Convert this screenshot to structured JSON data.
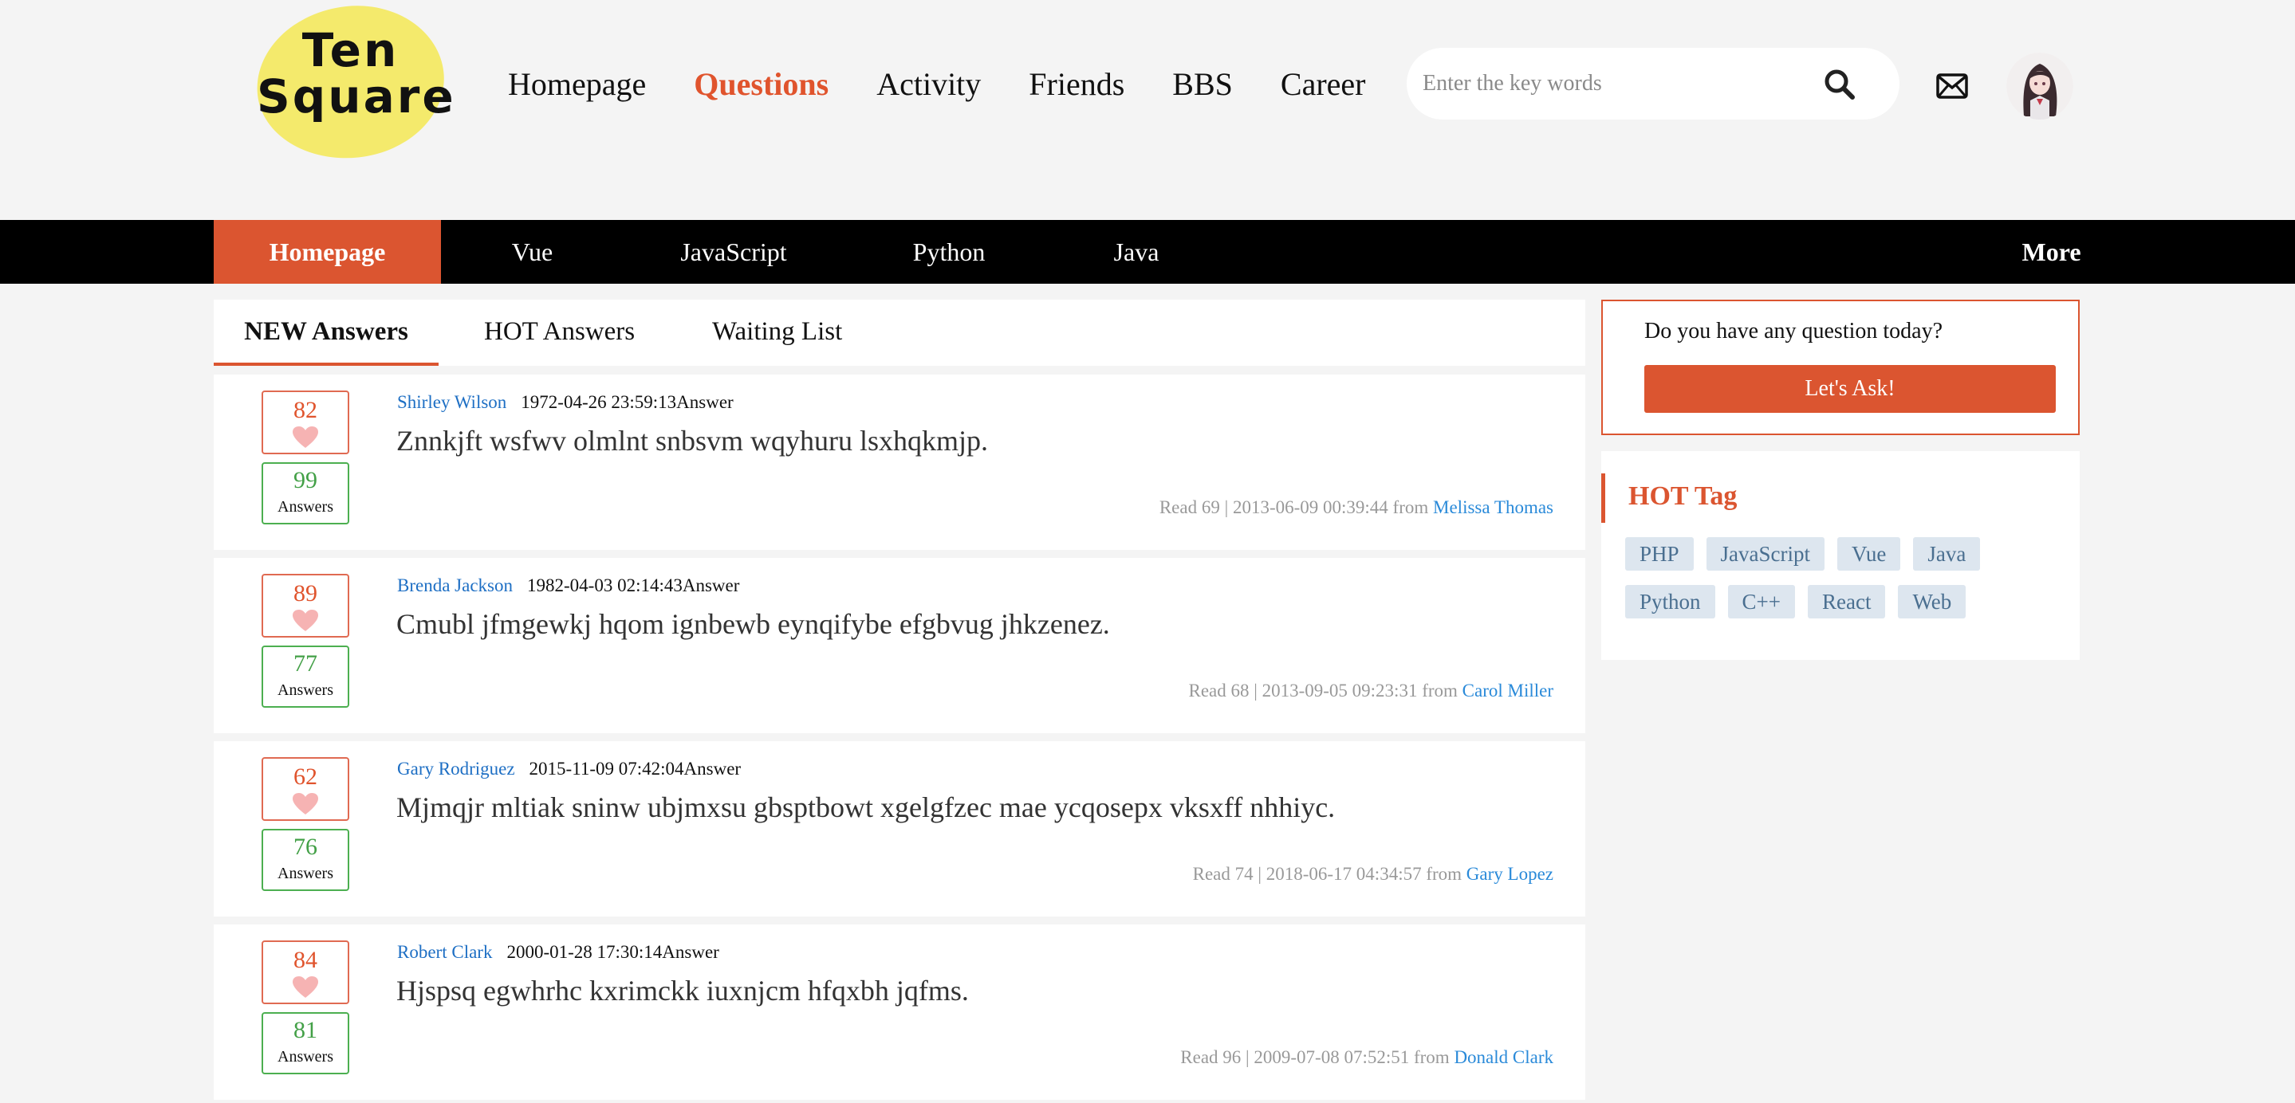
{
  "logo": {
    "line1": "Ten",
    "line2": "Square"
  },
  "nav": {
    "items": [
      {
        "label": "Homepage",
        "active": false
      },
      {
        "label": "Questions",
        "active": true
      },
      {
        "label": "Activity",
        "active": false
      },
      {
        "label": "Friends",
        "active": false
      },
      {
        "label": "BBS",
        "active": false
      },
      {
        "label": "Career",
        "active": false
      }
    ]
  },
  "search": {
    "placeholder": "Enter the key words",
    "icon": "search-icon"
  },
  "header_icons": {
    "mail": "mail-icon",
    "avatar": "avatar"
  },
  "categories": {
    "items": [
      "Homepage",
      "Vue",
      "JavaScript",
      "Python",
      "Java"
    ],
    "active": "Homepage",
    "more": "More"
  },
  "tabs": {
    "items": [
      "NEW Answers",
      "HOT Answers",
      "Waiting List"
    ],
    "active": "NEW Answers"
  },
  "questions": [
    {
      "likes": "82",
      "answers": "99",
      "answers_label": "Answers",
      "author": "Shirley Wilson",
      "time": "1972-04-26 23:59:13Answer",
      "title": "Znnkjft wsfwv olmlnt snbsvm wqyhuru lsxhqkmjp.",
      "read": "Read 69 | 2013-06-09 00:39:44 from ",
      "from": "Melissa Thomas"
    },
    {
      "likes": "89",
      "answers": "77",
      "answers_label": "Answers",
      "author": "Brenda Jackson",
      "time": "1982-04-03 02:14:43Answer",
      "title": "Cmubl jfmgewkj hqom ignbewb eynqifybe efgbvug jhkzenez.",
      "read": "Read 68 | 2013-09-05 09:23:31 from ",
      "from": "Carol Miller"
    },
    {
      "likes": "62",
      "answers": "76",
      "answers_label": "Answers",
      "author": "Gary Rodriguez",
      "time": "2015-11-09 07:42:04Answer",
      "title": "Mjmqjr mltiak sninw ubjmxsu gbsptbowt xgelgfzec mae ycqosepx vksxff nhhiyc.",
      "read": "Read 74 | 2018-06-17 04:34:57 from ",
      "from": "Gary Lopez"
    },
    {
      "likes": "84",
      "answers": "81",
      "answers_label": "Answers",
      "author": "Robert Clark",
      "time": "2000-01-28 17:30:14Answer",
      "title": "Hjspsq egwhrhc kxrimckk iuxnjcm hfqxbh jqfms.",
      "read": "Read 96 | 2009-07-08 07:52:51 from ",
      "from": "Donald Clark"
    }
  ],
  "ask": {
    "question": "Do you have any question today?",
    "button": "Let's Ask!"
  },
  "hot_tag": {
    "title": "HOT Tag",
    "tags": [
      "PHP",
      "JavaScript",
      "Vue",
      "Java",
      "Python",
      "C++",
      "React",
      "Web"
    ]
  },
  "colors": {
    "accent": "#db5530",
    "likes": "#e0542d",
    "answers": "#43a047",
    "link": "#1e6fc4",
    "logo": "#f4ea6c",
    "tag_bg": "#dde6ef"
  }
}
